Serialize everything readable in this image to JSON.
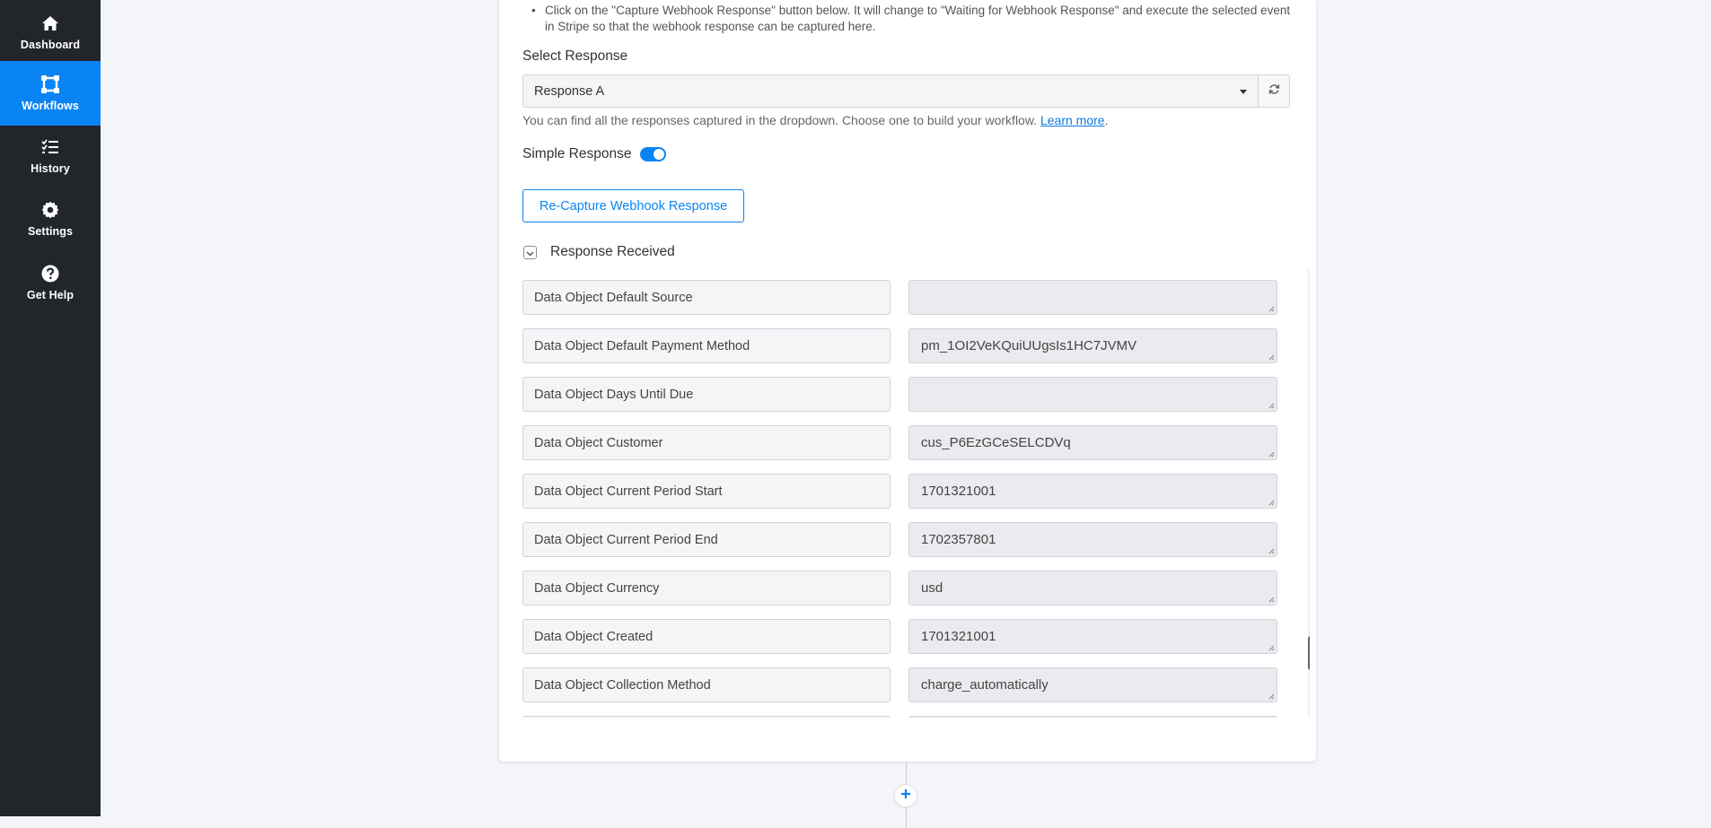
{
  "sidebar": {
    "items": [
      {
        "label": "Dashboard",
        "icon": "home-icon",
        "active": false
      },
      {
        "label": "Workflows",
        "icon": "workflow-icon",
        "active": true
      },
      {
        "label": "History",
        "icon": "history-list-icon",
        "active": false
      },
      {
        "label": "Settings",
        "icon": "gear-icon",
        "active": false
      },
      {
        "label": "Get Help",
        "icon": "question-icon",
        "active": false
      }
    ]
  },
  "instructions": "Click on the \"Capture Webhook Response\" button below. It will change to \"Waiting for Webhook Response\" and execute the selected event in Stripe so that the webhook response can be captured here.",
  "select_response": {
    "label": "Select Response",
    "value": "Response A",
    "helper_text": "You can find all the responses captured in the dropdown. Choose one to build your workflow.",
    "helper_link": "Learn more",
    "helper_suffix": "."
  },
  "simple_response": {
    "label": "Simple Response",
    "enabled": true
  },
  "recapture_button": "Re-Capture Webhook Response",
  "response_received": {
    "label": "Response Received",
    "fields": [
      {
        "key": "Data Object Default Source",
        "value": ""
      },
      {
        "key": "Data Object Default Payment Method",
        "value": "pm_1OI2VeKQuiUUgsIs1HC7JVMV"
      },
      {
        "key": "Data Object Days Until Due",
        "value": ""
      },
      {
        "key": "Data Object Customer",
        "value": "cus_P6EzGCeSELCDVq"
      },
      {
        "key": "Data Object Current Period Start",
        "value": "1701321001"
      },
      {
        "key": "Data Object Current Period End",
        "value": "1702357801"
      },
      {
        "key": "Data Object Currency",
        "value": "usd"
      },
      {
        "key": "Data Object Created",
        "value": "1701321001"
      },
      {
        "key": "Data Object Collection Method",
        "value": "charge_automatically"
      }
    ]
  },
  "colors": {
    "accent": "#0b84f3",
    "sidebar_bg": "#22262b"
  }
}
